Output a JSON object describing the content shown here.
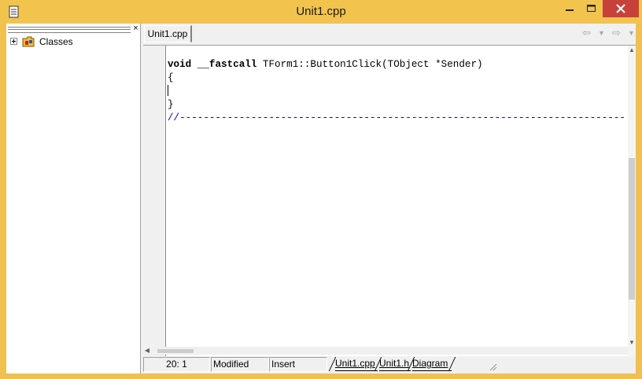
{
  "window": {
    "title": "Unit1.cpp",
    "icon": "document-icon",
    "controls": [
      "minimize-icon",
      "maximize-icon",
      "close-icon"
    ],
    "accent": "#f2c34d",
    "close_color": "#c7413a"
  },
  "explorer": {
    "close_glyph": "×",
    "tree": [
      {
        "label": "Classes",
        "icon": "classes-folder-icon",
        "expander": "+"
      }
    ]
  },
  "editor": {
    "tab": "Unit1.cpp",
    "nav": {
      "back_glyph": "⇦",
      "forward_glyph": "⇨",
      "drop_glyph": "▼"
    },
    "code": {
      "kw_void": "void",
      "kw_fastcall": "__fastcall",
      "signature_rest": " TForm1::Button1Click(TObject *Sender)",
      "open_brace": "{",
      "close_brace": "}",
      "separator": "//---------------------------------------------------------------------------"
    },
    "comment_color": "#0000aa"
  },
  "status": {
    "position": "20:   1",
    "modified": "Modified",
    "mode": "Insert",
    "tabs": [
      "Unit1.cpp",
      "Unit1.h",
      "Diagram"
    ]
  }
}
